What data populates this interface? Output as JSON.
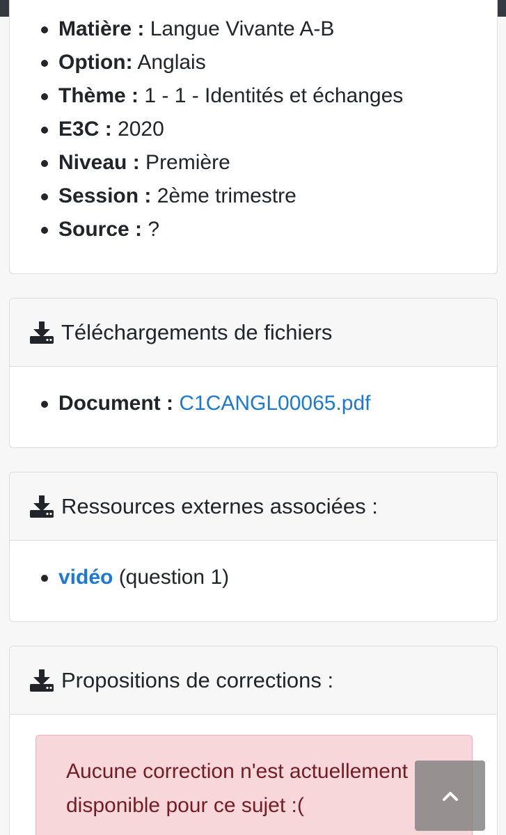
{
  "metadata": {
    "items": [
      {
        "label": "Matière :",
        "value": " Langue Vivante A-B"
      },
      {
        "label": "Option:",
        "value": " Anglais"
      },
      {
        "label": "Thème :",
        "value": " 1 - 1 - Identités et échanges"
      },
      {
        "label": "E3C :",
        "value": " 2020"
      },
      {
        "label": "Niveau :",
        "value": " Première"
      },
      {
        "label": "Session :",
        "value": " 2ème trimestre"
      },
      {
        "label": "Source :",
        "value": " ?"
      }
    ]
  },
  "downloads": {
    "title": "Téléchargements de fichiers",
    "icon": "download-icon",
    "document_label": "Document :",
    "document_link": "C1CANGL00065.pdf"
  },
  "resources": {
    "title": "Ressources externes associées :",
    "icon": "download-icon",
    "link": "vidéo",
    "suffix": " (question 1)"
  },
  "corrections": {
    "title": "Propositions de corrections :",
    "icon": "download-icon",
    "alert_line1": "Aucune correction n'est actuellement",
    "alert_line2": "disponible pour ce sujet :("
  },
  "scroll_top": {
    "icon": "chevron-up-icon"
  }
}
